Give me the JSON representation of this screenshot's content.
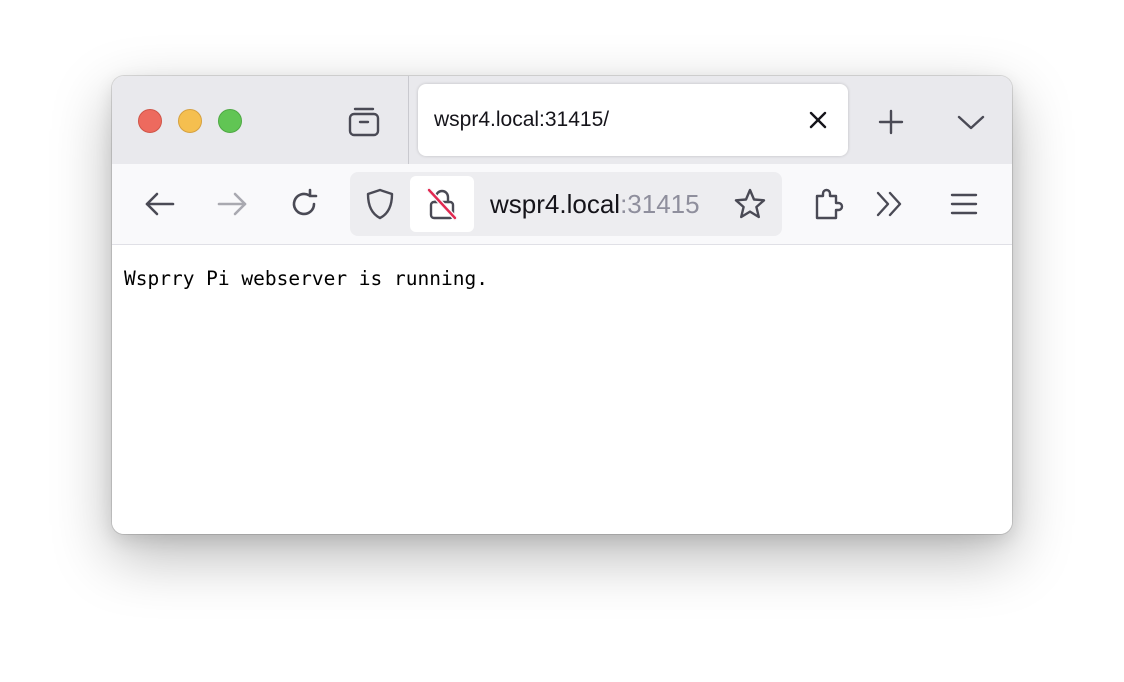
{
  "browser": {
    "tab": {
      "title": "wspr4.local:31415/"
    },
    "urlbar": {
      "host": "wspr4.local",
      "port": ":31415"
    },
    "icons": {
      "tab_manager": "tab-manager-icon",
      "tab_close": "close-icon",
      "new_tab": "plus-icon",
      "tab_list": "chevron-down-icon",
      "back": "back-arrow-icon",
      "forward": "forward-arrow-icon",
      "reload": "reload-icon",
      "tracking_protection": "shield-icon",
      "insecure_connection": "lock-crossed-icon",
      "bookmark": "star-icon",
      "extensions": "puzzle-icon",
      "overflow": "double-chevron-icon",
      "menu": "hamburger-menu-icon"
    },
    "colors": {
      "close_light": "#ed6a5e",
      "minimize_light": "#f5bf4f",
      "maximize_light": "#61c554",
      "insecure_slash": "#e22850",
      "forward_disabled": "#a9a9b0"
    }
  },
  "page": {
    "body_text": "Wsprry Pi webserver is running."
  }
}
